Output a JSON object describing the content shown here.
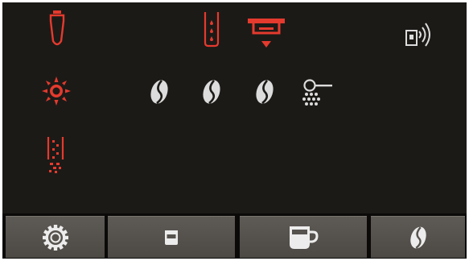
{
  "status_icons": {
    "row1": [
      "water-filter-icon",
      "water-tank-icon",
      "drip-tray-icon",
      "wireless-connect-icon"
    ],
    "row2": [
      "rinse-icon",
      "coffee-bean-icon",
      "coffee-bean-icon",
      "coffee-bean-icon",
      "ground-coffee-icon"
    ],
    "row3": [
      "descale-icon"
    ]
  },
  "bottom_bar": {
    "buttons": [
      "settings-button",
      "small-cup-button",
      "large-cup-button",
      "coffee-strength-button"
    ]
  },
  "colors": {
    "screen_background": "#1c1a17",
    "alert": "#e53a2e",
    "icon": "#dcdcdc",
    "button": "#56524d"
  }
}
